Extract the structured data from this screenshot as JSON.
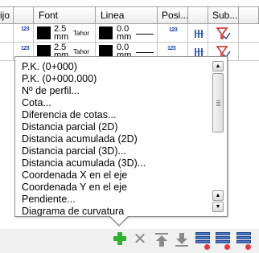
{
  "table": {
    "headers": [
      "ijo",
      "",
      "Font",
      "Linea",
      "Posi...",
      "",
      "Sub..."
    ],
    "rows": [
      {
        "size": "2.5",
        "unit": "mm",
        "font": "Tahor",
        "width": "0.0",
        "width_unit": "mm",
        "pos": "123"
      },
      {
        "size": "2.5",
        "unit": "mm",
        "font": "Tahor",
        "width": "0.0",
        "width_unit": "mm",
        "pos": "123"
      }
    ]
  },
  "popup": {
    "items": [
      "P.K. (0+000)",
      "P.K. (0+000.000)",
      "Nº de perfil...",
      "Cota...",
      "Diferencia de cotas...",
      "Distancia parcial (2D)",
      "Distancia acumulada (2D)",
      "Distancia parcial (3D)...",
      "Distancia acumulada (3D)...",
      "Coordenada X en el eje",
      "Coordenada Y en el eje",
      "Pendiente...",
      "Diagrama de curvatura"
    ]
  },
  "toolbar": {
    "icons": [
      "add-icon",
      "delete-icon",
      "move-up-icon",
      "move-down-icon",
      "list-remove-icon",
      "list-remove-icon",
      "list-remove-icon"
    ]
  },
  "colors": {
    "add": "#2fb22f",
    "accent_blue": "#1b3fb8",
    "filter_red": "#d02020"
  }
}
